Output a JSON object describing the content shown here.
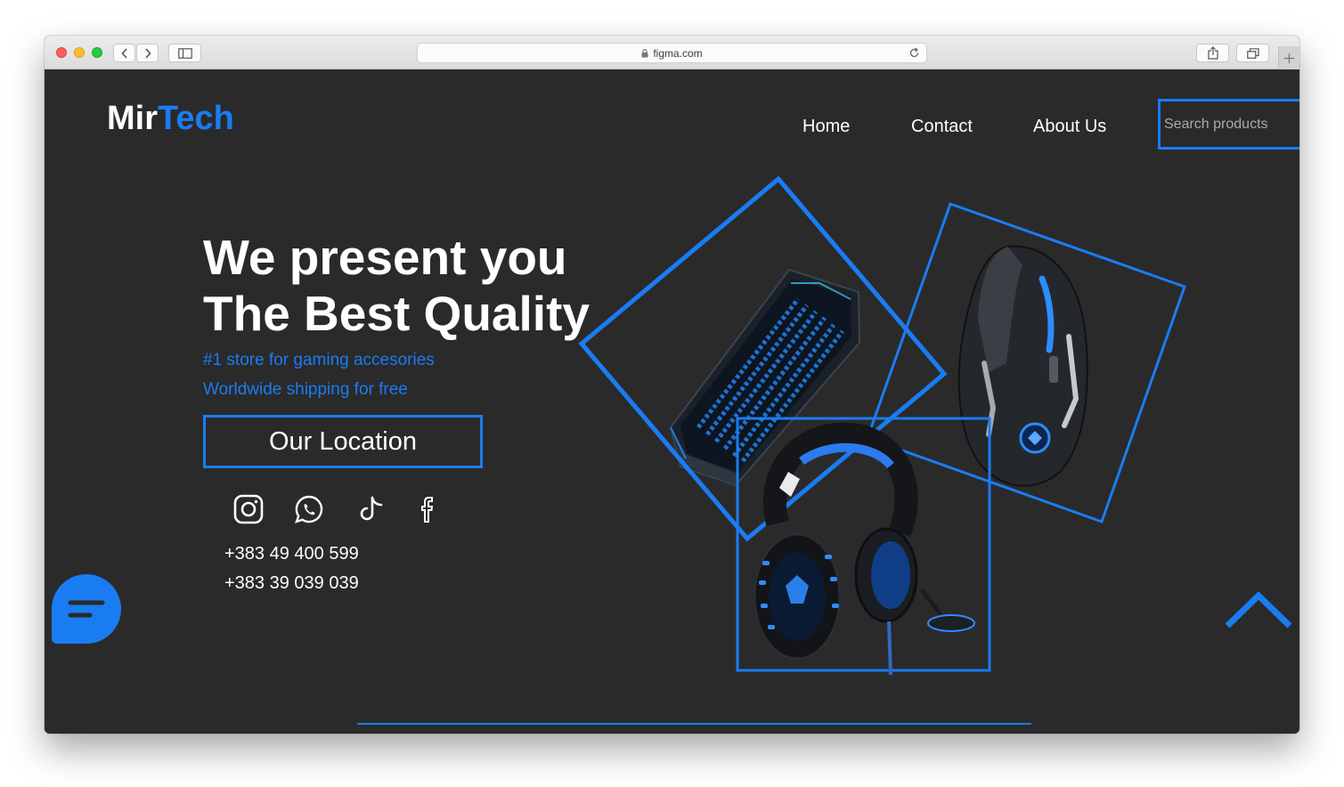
{
  "browser": {
    "url": "figma.com"
  },
  "brand": {
    "part1": "Mir",
    "part2": "Tech"
  },
  "nav": {
    "items": [
      {
        "label": "Home"
      },
      {
        "label": "Contact"
      },
      {
        "label": "About Us"
      }
    ],
    "search_placeholder": "Search products"
  },
  "hero": {
    "title_line1": "We present you",
    "title_line2": "The Best Quality",
    "tagline1": "#1 store for gaming accesories",
    "tagline2": "Worldwide shipping for free",
    "cta_label": "Our Location"
  },
  "social": [
    "instagram-icon",
    "whatsapp-icon",
    "tiktok-icon",
    "facebook-icon"
  ],
  "contact": {
    "phones": [
      "+383 49 400 599",
      "+383 39 039 039"
    ]
  },
  "colors": {
    "accent": "#1a7cf2",
    "background": "#2a2a2b",
    "text": "#ffffff"
  },
  "icons": {
    "chat": "chat-icon",
    "scroll_top": "chevron-up-icon",
    "products": [
      "keyboard-icon",
      "mouse-icon",
      "headset-icon"
    ]
  }
}
